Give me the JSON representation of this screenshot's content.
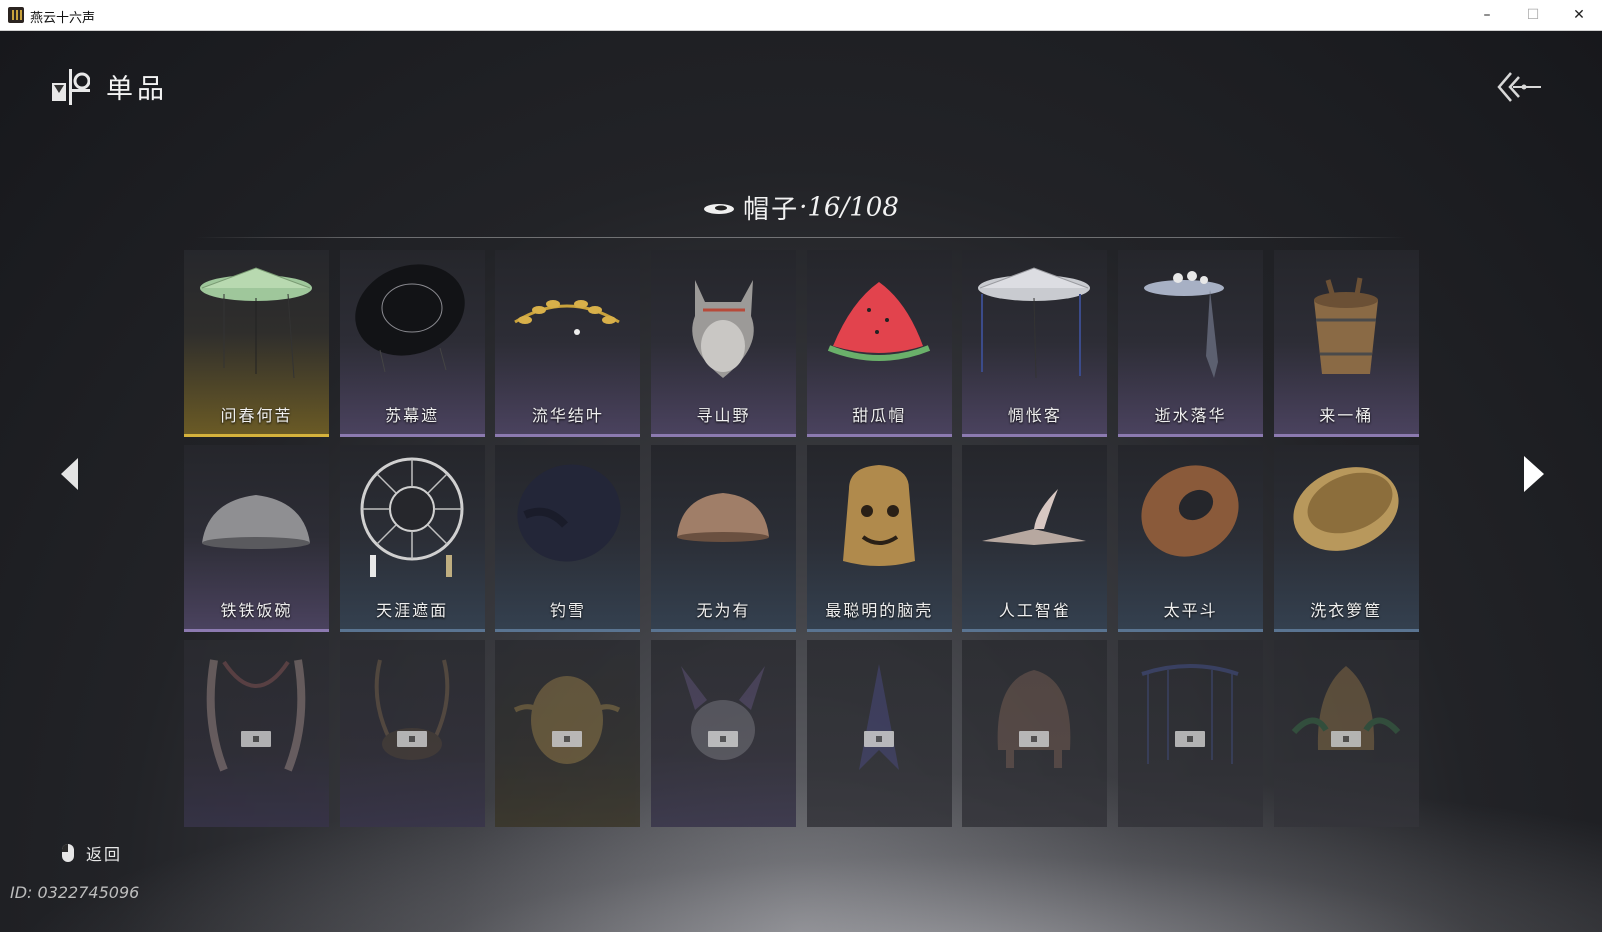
{
  "window": {
    "title": "燕云十六声",
    "minimize": "–",
    "maximize": "☐",
    "close": "✕"
  },
  "header": {
    "title": "单品",
    "icon": "wardrobe-icon",
    "back_icon": "double-chevron-back-icon"
  },
  "category": {
    "icon": "hat-icon",
    "title": "帽子",
    "separator": "·",
    "count": "16/108"
  },
  "grid": {
    "rows": [
      [
        {
          "label": "问春何苦",
          "rarity": "gold",
          "icon": "green-bamboo-hat"
        },
        {
          "label": "苏幕遮",
          "rarity": "purple",
          "icon": "black-veiled-hat"
        },
        {
          "label": "流华结叶",
          "rarity": "purple",
          "icon": "golden-laurel"
        },
        {
          "label": "寻山野",
          "rarity": "purple",
          "icon": "wolf-head"
        },
        {
          "label": "甜瓜帽",
          "rarity": "purple",
          "icon": "watermelon-hat"
        },
        {
          "label": "惆怅客",
          "rarity": "purple",
          "icon": "white-veiled-hat"
        },
        {
          "label": "逝水落华",
          "rarity": "purple",
          "icon": "flower-hat-with-scarf"
        },
        {
          "label": "来一桶",
          "rarity": "purple",
          "icon": "wooden-bucket"
        }
      ],
      [
        {
          "label": "铁铁饭碗",
          "rarity": "purple",
          "icon": "iron-bowl"
        },
        {
          "label": "天涯遮面",
          "rarity": "blue",
          "icon": "wicker-wheel-hat"
        },
        {
          "label": "钓雪",
          "rarity": "blue",
          "icon": "dark-straw-hat"
        },
        {
          "label": "无为有",
          "rarity": "blue",
          "icon": "wooden-bowl"
        },
        {
          "label": "最聪明的脑壳",
          "rarity": "blue",
          "icon": "bronze-bell"
        },
        {
          "label": "人工智雀",
          "rarity": "blue",
          "icon": "bird-hat"
        },
        {
          "label": "太平斗",
          "rarity": "blue",
          "icon": "woven-basket-hat"
        },
        {
          "label": "洗衣箩筐",
          "rarity": "blue",
          "icon": "laundry-basket"
        }
      ],
      [
        {
          "label": "",
          "rarity": "locked-purple",
          "icon": "feather-horns"
        },
        {
          "label": "",
          "rarity": "locked-purple",
          "icon": "antler-crown"
        },
        {
          "label": "",
          "rarity": "locked-gold",
          "icon": "golden-mask"
        },
        {
          "label": "",
          "rarity": "locked-purple",
          "icon": "demon-horns"
        },
        {
          "label": "",
          "rarity": "locked",
          "icon": "blue-plume"
        },
        {
          "label": "",
          "rarity": "locked",
          "icon": "ornate-helmet"
        },
        {
          "label": "",
          "rarity": "locked",
          "icon": "beaded-veil"
        },
        {
          "label": "",
          "rarity": "locked",
          "icon": "green-horn-helmet"
        }
      ]
    ]
  },
  "nav": {
    "prev_icon": "triangle-left-icon",
    "next_icon": "triangle-right-icon"
  },
  "footer": {
    "back_label": "返回",
    "back_icon": "mouse-right-click-icon",
    "user_id": "ID: 0322745096"
  }
}
